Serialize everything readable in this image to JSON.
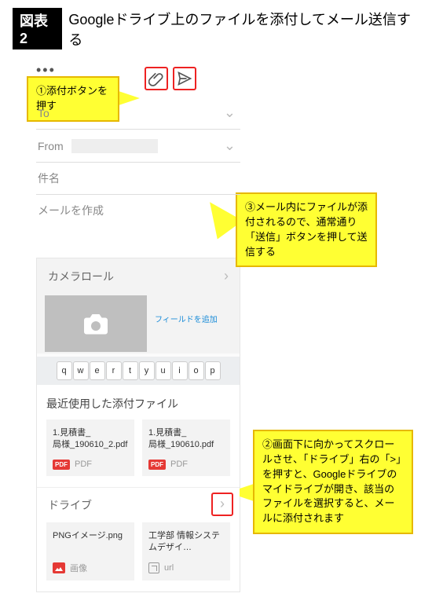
{
  "header": {
    "badge": "図表2",
    "title": "Googleドライブ上のファイルを添付してメール送信する"
  },
  "callouts": {
    "c1": "①添付ボタンを押す",
    "c2": "②画面下に向かってスクロールさせ、「ドライブ」右の「>」を押すと、Googleドライブのマイドライブが開き、該当のファイルを選択すると、メールに添付されます",
    "c3": "③メール内にファイルが添付されるので、通常通り「送信」ボタンを押して送信する"
  },
  "mail": {
    "to_label": "To",
    "from_label": "From",
    "subject_placeholder": "件名",
    "body_placeholder": "メールを作成",
    "more": "•••"
  },
  "attach": {
    "camera_roll": "カメラロール",
    "add_field": "フィールドを追加",
    "keys": [
      "q",
      "w",
      "e",
      "r",
      "t",
      "y",
      "u",
      "i",
      "o",
      "p"
    ],
    "recent_title": "最近使用した添付ファイル",
    "recent": [
      {
        "name": "1.見積書_\n局様_190610_2.pdf",
        "type_label": "PDF",
        "badge": "PDF"
      },
      {
        "name": "1.見積書_\n局様_190610.pdf",
        "type_label": "PDF",
        "badge": "PDF"
      }
    ],
    "drive_label": "ドライブ",
    "drive_files": [
      {
        "name": "PNGイメージ.png",
        "type_label": "画像",
        "kind": "image"
      },
      {
        "name": "工学部 情報システムデザイ…",
        "type_label": "url",
        "kind": "url"
      }
    ]
  }
}
